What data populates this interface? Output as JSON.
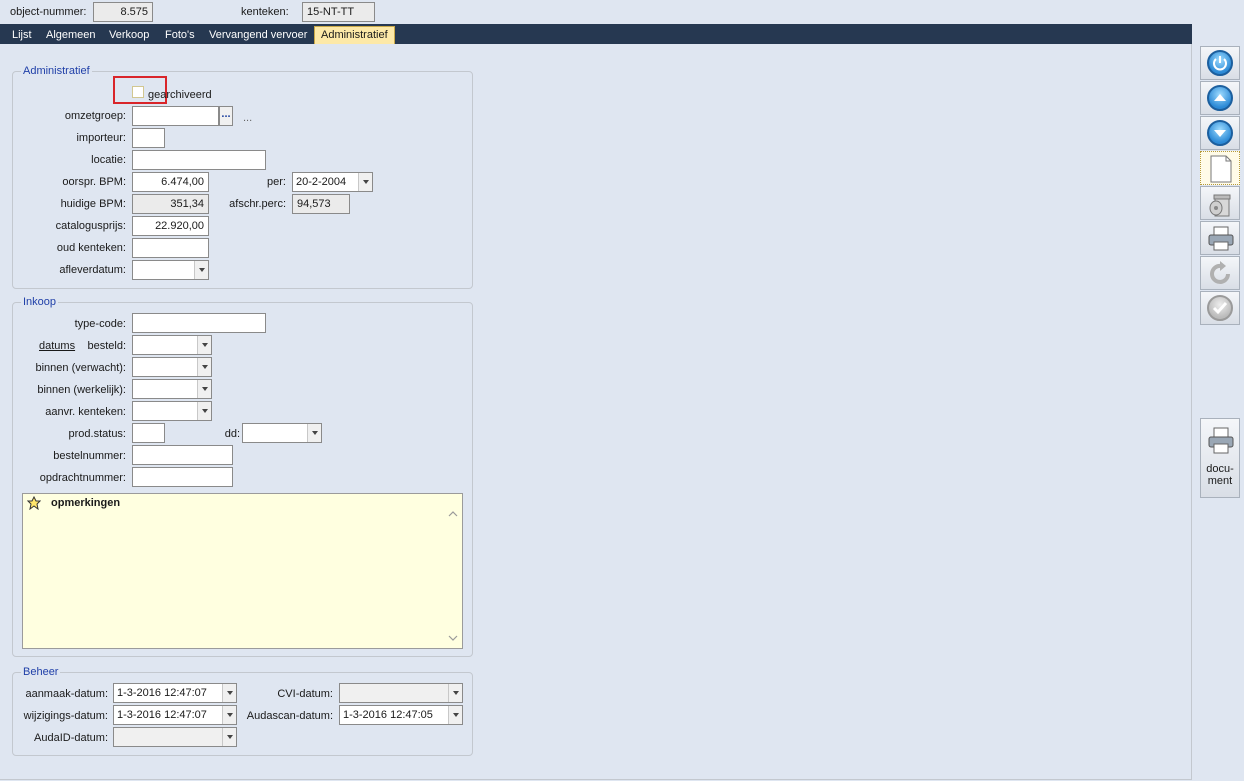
{
  "header": {
    "object_label": "object-nummer:",
    "object_value": "8.575",
    "kenteken_label": "kenteken:",
    "kenteken_value": "15-NT-TT"
  },
  "tabs": [
    "Lijst",
    "Algemeen",
    "Verkoop",
    "Foto's",
    "Vervangend vervoer",
    "Administratief"
  ],
  "active_tab": "Administratief",
  "administratief": {
    "title": "Administratief",
    "gearchiveerd_label": "gearchiveerd",
    "gearchiveerd_checked": false,
    "omzetgroep_label": "omzetgroep:",
    "omzetgroep_value": "",
    "omzetgroep_button": "...",
    "omzetgroep_desc": "...",
    "importeur_label": "importeur:",
    "importeur_value": "",
    "locatie_label": "locatie:",
    "locatie_value": "",
    "oorspr_bpm_label": "oorspr. BPM:",
    "oorspr_bpm_value": "6.474,00",
    "per_label": "per:",
    "per_value": "20-2-2004",
    "huidige_bpm_label": "huidige BPM:",
    "huidige_bpm_value": "351,34",
    "afschr_label": "afschr.perc:",
    "afschr_value": "94,573",
    "catalogus_label": "catalogusprijs:",
    "catalogus_value": "22.920,00",
    "oud_kenteken_label": "oud kenteken:",
    "oud_kenteken_value": "",
    "aflever_label": "afleverdatum:",
    "aflever_value": ""
  },
  "inkoop": {
    "title": "Inkoop",
    "typecode_label": "type-code:",
    "typecode_value": "",
    "datums_link": "datums",
    "besteld_label": "besteld:",
    "besteld_value": "",
    "binnen_verwacht_label": "binnen (verwacht):",
    "binnen_verwacht_value": "",
    "binnen_werkelijk_label": "binnen (werkelijk):",
    "binnen_werkelijk_value": "",
    "aanvr_label": "aanvr. kenteken:",
    "aanvr_value": "",
    "prodstatus_label": "prod.status:",
    "prodstatus_value": "",
    "dd_label": "dd:",
    "dd_value": "",
    "bestelnummer_label": "bestelnummer:",
    "bestelnummer_value": "",
    "opdrachtnummer_label": "opdrachtnummer:",
    "opdrachtnummer_value": "",
    "notes_title": "opmerkingen",
    "notes_value": ""
  },
  "beheer": {
    "title": "Beheer",
    "aanmaak_label": "aanmaak-datum:",
    "aanmaak_value": "1-3-2016 12:47:07",
    "wijzigings_label": "wijzigings-datum:",
    "wijzigings_value": "1-3-2016 12:47:07",
    "audaid_label": "AudaID-datum:",
    "audaid_value": "",
    "cvi_label": "CVI-datum:",
    "cvi_value": "",
    "audascan_label": "Audascan-datum:",
    "audascan_value": "1-3-2016 12:47:05"
  },
  "toolbar": {
    "items": [
      "power-icon",
      "arrow-up-icon",
      "arrow-down-icon",
      "new-document-icon",
      "trash-icon",
      "print-icon",
      "refresh-icon",
      "check-icon"
    ],
    "document_label": "docu-\nment"
  },
  "colors": {
    "tabbar": "#263851",
    "active_tab": "#fde9a8",
    "group_title": "#1f3fa8",
    "highlight": "#d9252a",
    "notes_bg": "#ffffe0"
  }
}
